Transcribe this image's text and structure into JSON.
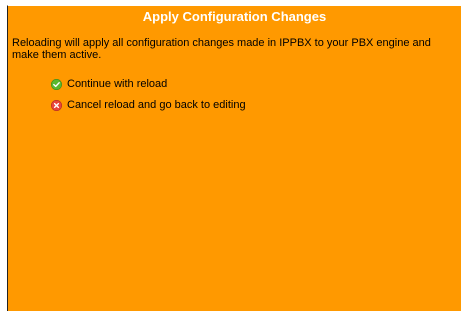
{
  "dialog": {
    "title": "Apply Configuration Changes",
    "message": "Reloading will apply all configuration changes made in IPPBX to your PBX engine and make them active.",
    "actions": [
      {
        "label": "Continue with reload",
        "icon": "check-circle-icon",
        "color": "#5cb82e"
      },
      {
        "label": "Cancel reload and go back to editing",
        "icon": "x-circle-icon",
        "color": "#e8463c"
      }
    ]
  },
  "colors": {
    "background": "#ff9900",
    "title_text": "#ffffff"
  }
}
